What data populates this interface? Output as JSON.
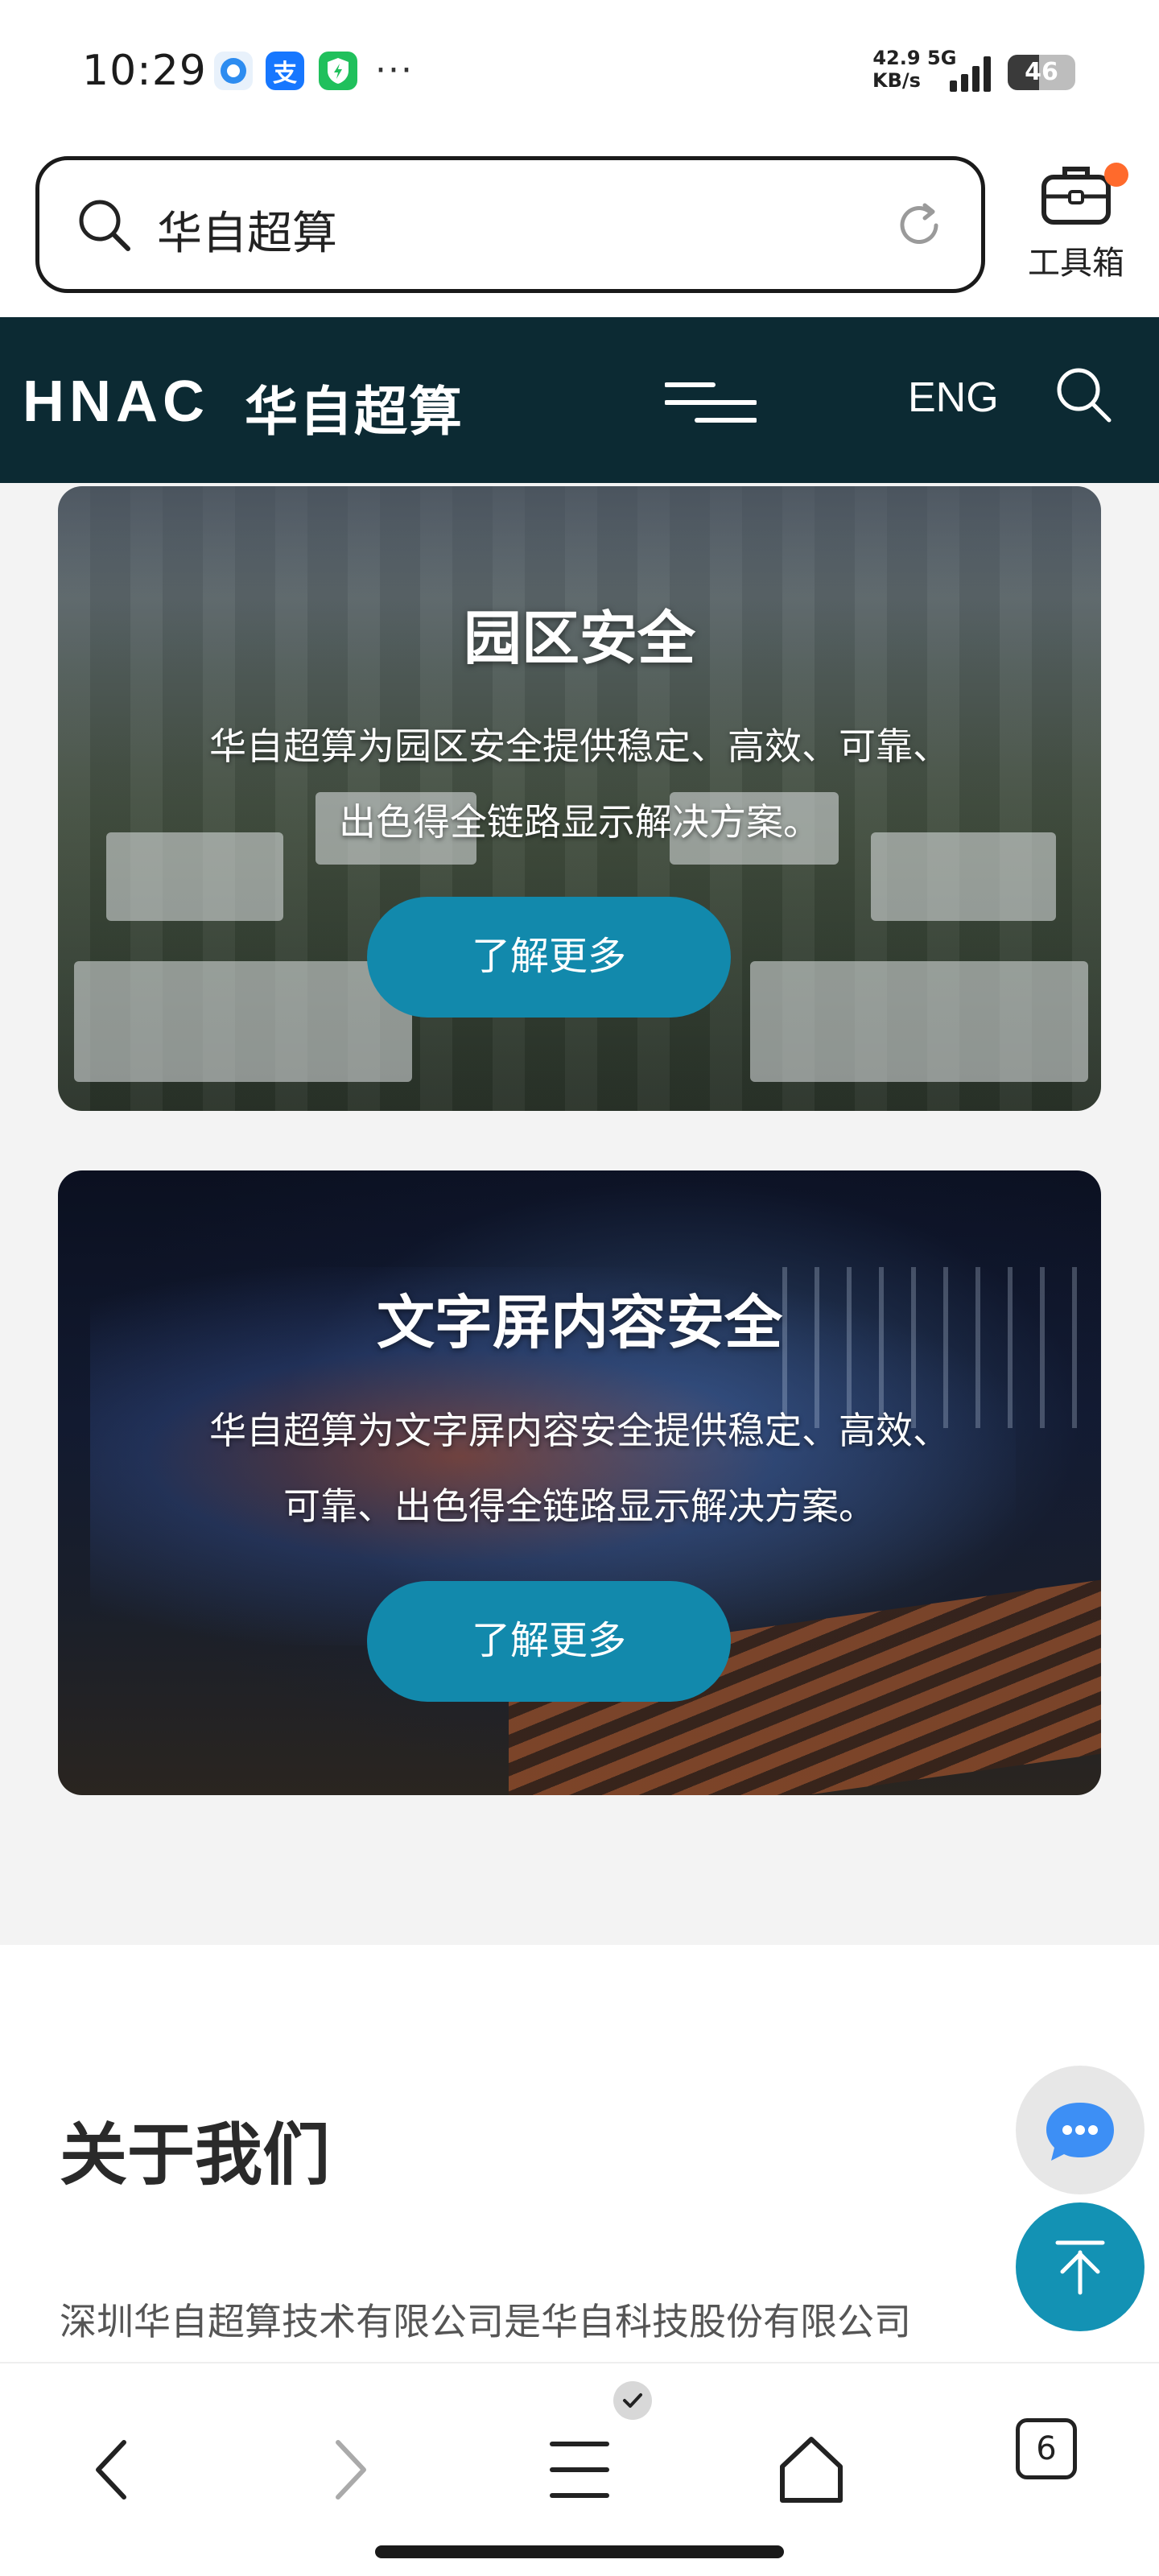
{
  "status_bar": {
    "time": "10:29",
    "net_speed_value": "42.9",
    "net_speed_unit": "KB/s",
    "network": "5G",
    "battery": "46",
    "battery_level": 0.46,
    "more": "···"
  },
  "browser": {
    "search_text": "华自超算",
    "toolbox_label": "工具箱"
  },
  "site_header": {
    "logo_en": "HNAC",
    "logo_cn": "华自超算",
    "lang": "ENG"
  },
  "cards": [
    {
      "title": "园区安全",
      "desc_line1": "华自超算为园区安全提供稳定、高效、可靠、",
      "desc_line2": "出色得全链路显示解决方案。",
      "button": "了解更多"
    },
    {
      "title": "文字屏内容安全",
      "desc_line1": "华自超算为文字屏内容安全提供稳定、高效、",
      "desc_line2": "可靠、出色得全链路显示解决方案。",
      "button": "了解更多"
    }
  ],
  "about": {
    "title": "关于我们",
    "text": "深圳华自超算技术有限公司是华自科技股份有限公司"
  },
  "bottom_nav": {
    "tab_count": "6"
  },
  "colors": {
    "header_bg": "#0c2a33",
    "button_bg": "#1289ac",
    "fab_top_bg": "#1392b4",
    "notification_dot": "#ff6a2c"
  }
}
